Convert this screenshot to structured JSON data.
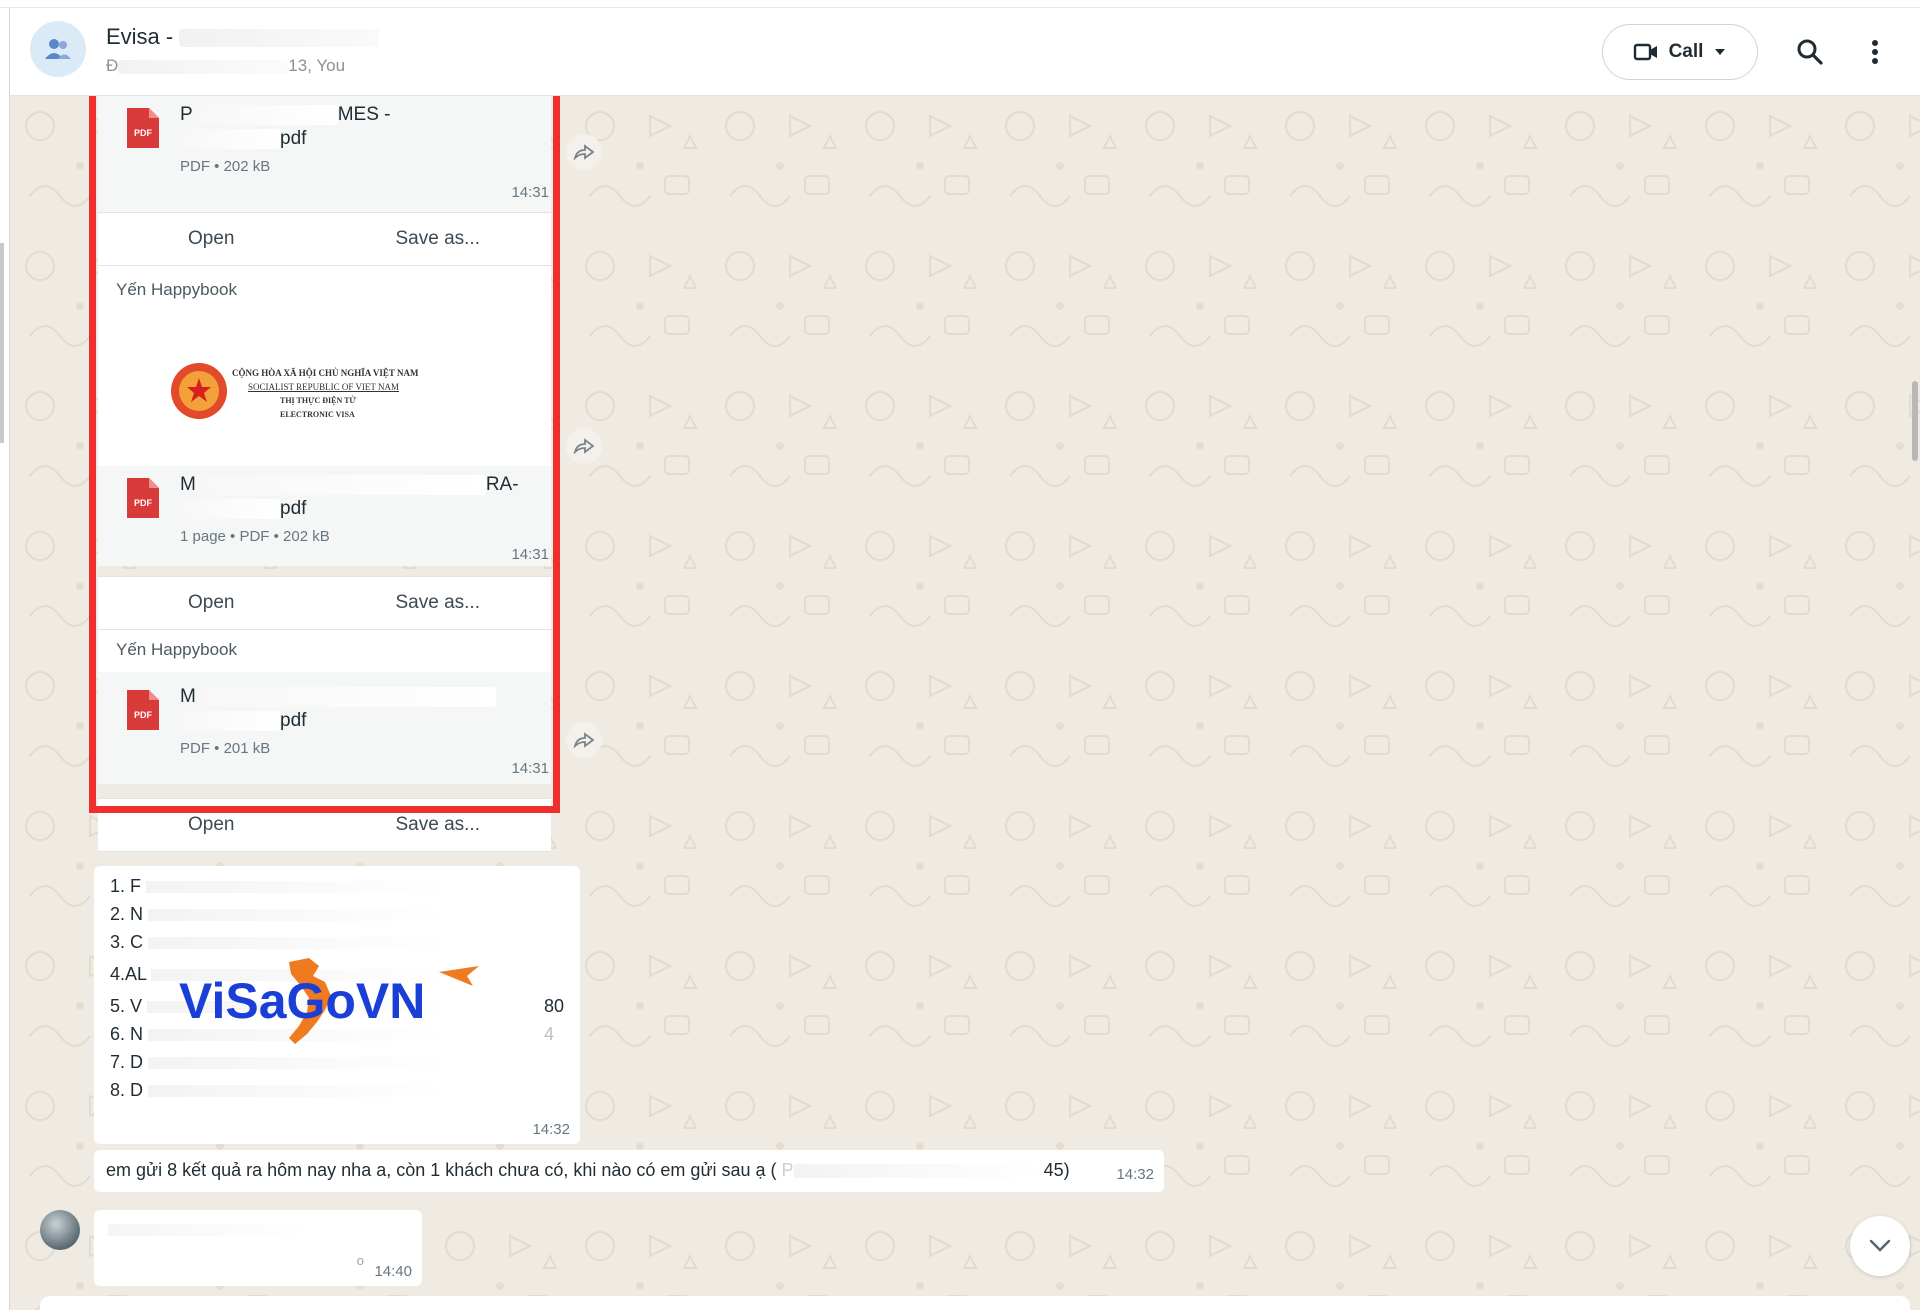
{
  "header": {
    "title": "Evisa -",
    "subtitle_start": "Đ",
    "subtitle_end": "13, You",
    "call_label": "Call"
  },
  "messages": {
    "file1": {
      "name_start": "P",
      "name_mid": "MES -",
      "name_ext": "pdf",
      "meta": "PDF • 202 kB",
      "time": "14:31",
      "open_label": "Open",
      "save_label": "Save as..."
    },
    "file2": {
      "sender": "Yến Happybook",
      "preview_line1": "CỘNG HÒA XÃ HỘI CHỦ NGHĨA VIỆT NAM",
      "preview_line2": "SOCIALIST REPUBLIC OF VIET NAM",
      "preview_line3": "THỊ THỰC ĐIỆN TỬ",
      "preview_line4": "ELECTRONIC VISA",
      "name_start": "M",
      "name_mid": "RA-",
      "name_ext": "pdf",
      "meta": "1 page • PDF • 202 kB",
      "time": "14:31",
      "open_label": "Open",
      "save_label": "Save as..."
    },
    "file3": {
      "sender": "Yến Happybook",
      "name_start": "M",
      "name_ext": "pdf",
      "meta": "PDF • 201 kB",
      "time": "14:31",
      "open_label": "Open",
      "save_label": "Save as..."
    },
    "list": {
      "items": [
        "1.  F",
        "2.  N",
        "3.  C",
        "4.AL",
        "5.  V",
        "6.  N",
        "7.  D",
        "8.  D"
      ],
      "extra_5": "80",
      "extra_6": "4",
      "logo_text": "ViSaGoVN",
      "time": "14:32"
    },
    "text": {
      "body": "em gửi 8 kết quả ra hôm nay nha a, còn 1 khách chưa có, khi nào có em gửi sau ạ (",
      "body_start_blur": "P",
      "body_end": "45)",
      "time": "14:32"
    },
    "last": {
      "mark": "o",
      "time": "14:40"
    }
  },
  "colors": {
    "highlight": "#ef2e2e",
    "pdf_red": "#d93a3a",
    "chat_bg": "#efeae2",
    "logo_blue": "#1a3fd6",
    "logo_orange": "#f07a1e"
  }
}
